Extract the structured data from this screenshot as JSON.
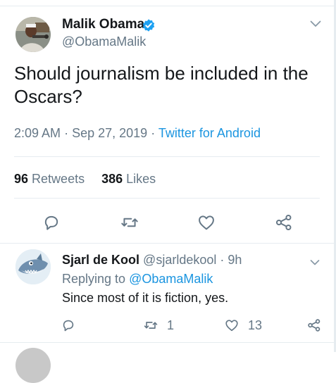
{
  "main_tweet": {
    "author_name": "Malik Obama",
    "author_handle": "@ObamaMalik",
    "text": "Should journalism be included in the Oscars?",
    "time": "2:09 AM",
    "date": "Sep 27, 2019",
    "separator": "·",
    "source": "Twitter for Android",
    "retweets_count": "96",
    "retweets_label": "Retweets",
    "likes_count": "386",
    "likes_label": "Likes"
  },
  "reply_tweet": {
    "author_name": "Sjarl de Kool",
    "author_handle": "@sjarldekool",
    "separator": "·",
    "age": "9h",
    "replying_label": "Replying to",
    "replying_to": "@ObamaMalik",
    "text": "Since most of it is fiction, yes.",
    "retweets_count": "1",
    "likes_count": "13"
  },
  "icons": {
    "verified": "verified-badge-icon",
    "chevron": "chevron-down-icon",
    "reply": "reply-icon",
    "retweet": "retweet-icon",
    "like": "heart-icon",
    "share": "share-icon"
  },
  "colors": {
    "link_blue": "#1b95e0",
    "verified_blue": "#1da1f2",
    "secondary_text": "#657786",
    "primary_text": "#14171a",
    "divider": "#e6ecf0"
  }
}
